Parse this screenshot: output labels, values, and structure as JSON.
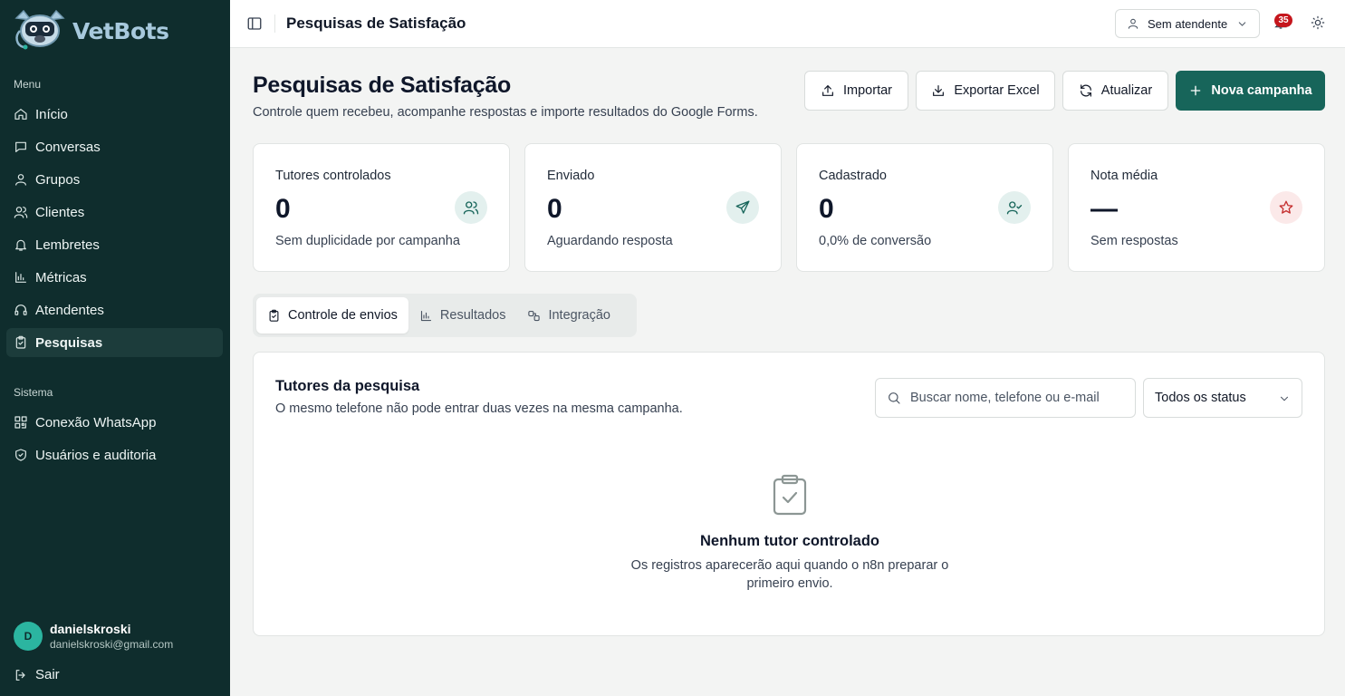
{
  "app": {
    "brand": "VetBots",
    "accent_color": "#17655a",
    "sidebar_color": "#0f2d2d"
  },
  "sidebar": {
    "menu_label": "Menu",
    "menu_items": [
      {
        "label": "Início",
        "icon": "home-icon"
      },
      {
        "label": "Conversas",
        "icon": "chat-icon"
      },
      {
        "label": "Grupos",
        "icon": "user-icon"
      },
      {
        "label": "Clientes",
        "icon": "users-icon"
      },
      {
        "label": "Lembretes",
        "icon": "bell-icon"
      },
      {
        "label": "Métricas",
        "icon": "bar-chart-icon"
      },
      {
        "label": "Atendentes",
        "icon": "headset-icon"
      },
      {
        "label": "Pesquisas",
        "icon": "clipboard-check-icon",
        "active": true
      }
    ],
    "system_label": "Sistema",
    "system_items": [
      {
        "label": "Conexão WhatsApp",
        "icon": "qr-code-icon"
      },
      {
        "label": "Usuários e auditoria",
        "icon": "shield-icon"
      }
    ],
    "user": {
      "initial": "D",
      "name": "danielskroski",
      "email": "danielskroski@gmail.com"
    },
    "logout_label": "Sair"
  },
  "topbar": {
    "title": "Pesquisas de Satisfação",
    "attendant_label": "Sem atendente",
    "notification_count": "35"
  },
  "header": {
    "title": "Pesquisas de Satisfação",
    "subtitle": "Controle quem recebeu, acompanhe respostas e importe resultados do Google Forms.",
    "buttons": {
      "import": "Importar",
      "export": "Exportar Excel",
      "refresh": "Atualizar",
      "new_campaign": "Nova campanha"
    }
  },
  "stats": [
    {
      "label": "Tutores controlados",
      "value": "0",
      "sub": "Sem duplicidade por campanha",
      "icon": "users-icon"
    },
    {
      "label": "Enviado",
      "value": "0",
      "sub": "Aguardando resposta",
      "icon": "send-icon"
    },
    {
      "label": "Cadastrado",
      "value": "0",
      "sub": "0,0% de conversão",
      "icon": "user-check-icon"
    },
    {
      "label": "Nota média",
      "value": "—",
      "sub": "Sem respostas",
      "icon": "star-icon"
    }
  ],
  "tabs": [
    {
      "label": "Controle de envios",
      "active": true
    },
    {
      "label": "Resultados"
    },
    {
      "label": "Integração"
    }
  ],
  "panel": {
    "title": "Tutores da pesquisa",
    "subtitle": "O mesmo telefone não pode entrar duas vezes na mesma campanha.",
    "search_placeholder": "Buscar nome, telefone ou e-mail",
    "status_filter": "Todos os status",
    "empty_title": "Nenhum tutor controlado",
    "empty_subtitle": "Os registros aparecerão aqui quando o n8n preparar o primeiro envio."
  }
}
